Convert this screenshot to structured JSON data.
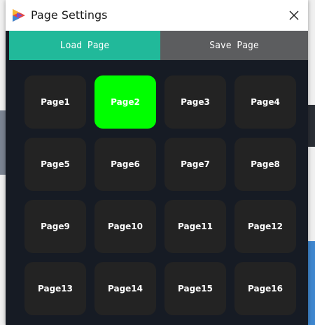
{
  "dialog": {
    "title": "Page Settings",
    "close_symbol": "✕",
    "icon": "app-logo-icon"
  },
  "tabs": [
    {
      "label": "Load Page",
      "active": true,
      "color": "#21b99a"
    },
    {
      "label": "Save Page",
      "active": false,
      "color": "#5c5d5f"
    }
  ],
  "pages": [
    {
      "label": "Page1",
      "selected": false
    },
    {
      "label": "Page2",
      "selected": true
    },
    {
      "label": "Page3",
      "selected": false
    },
    {
      "label": "Page4",
      "selected": false
    },
    {
      "label": "Page5",
      "selected": false
    },
    {
      "label": "Page6",
      "selected": false
    },
    {
      "label": "Page7",
      "selected": false
    },
    {
      "label": "Page8",
      "selected": false
    },
    {
      "label": "Page9",
      "selected": false
    },
    {
      "label": "Page10",
      "selected": false
    },
    {
      "label": "Page11",
      "selected": false
    },
    {
      "label": "Page12",
      "selected": false
    },
    {
      "label": "Page13",
      "selected": false
    },
    {
      "label": "Page14",
      "selected": false
    },
    {
      "label": "Page15",
      "selected": false
    },
    {
      "label": "Page16",
      "selected": false
    }
  ],
  "colors": {
    "panel_bg": "#161b24",
    "button_bg": "#232323",
    "selected_bg": "#00ff00"
  }
}
